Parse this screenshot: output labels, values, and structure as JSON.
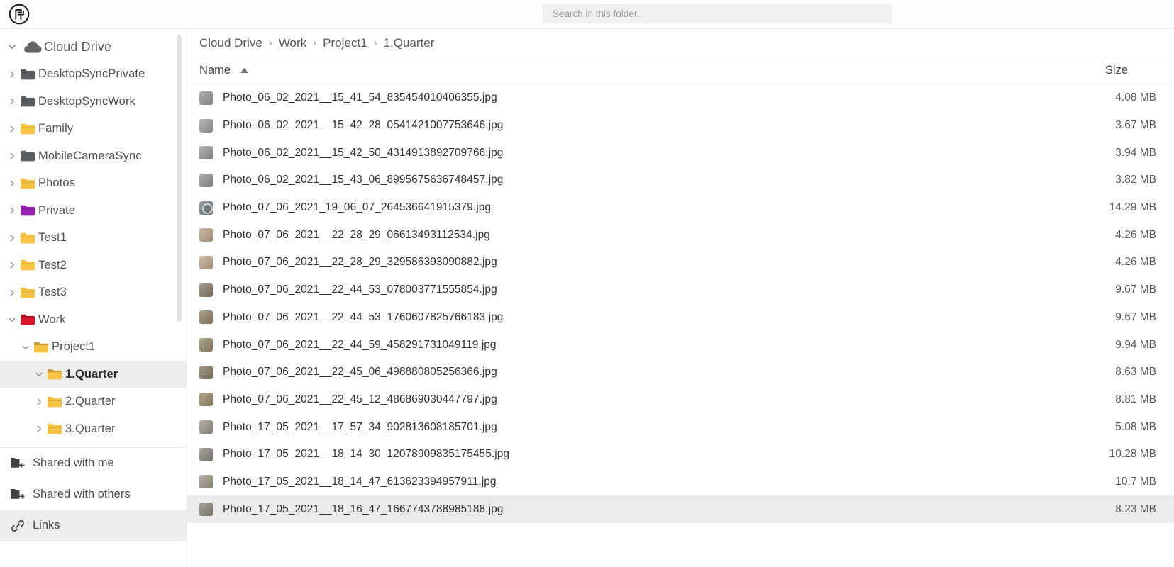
{
  "app": {
    "logo_name": "app-logo"
  },
  "search": {
    "placeholder": "Search in this folder..",
    "value": ""
  },
  "sidebar": {
    "root": {
      "label": "Cloud Drive",
      "icon": "cloud-icon",
      "expanded": true
    },
    "tree": [
      {
        "label": "DesktopSyncPrivate",
        "icon": "folder-icon",
        "color": "#5b5e62",
        "depth": 1,
        "expanded": false,
        "selected": false
      },
      {
        "label": "DesktopSyncWork",
        "icon": "folder-icon",
        "color": "#5b5e62",
        "depth": 1,
        "expanded": false,
        "selected": false
      },
      {
        "label": "Family",
        "icon": "folder-icon",
        "color": "#f6c344",
        "depth": 1,
        "expanded": false,
        "selected": false
      },
      {
        "label": "MobileCameraSync",
        "icon": "folder-icon",
        "color": "#5b5e62",
        "depth": 1,
        "expanded": false,
        "selected": false
      },
      {
        "label": "Photos",
        "icon": "folder-icon",
        "color": "#f6c344",
        "depth": 1,
        "expanded": false,
        "selected": false
      },
      {
        "label": "Private",
        "icon": "folder-icon",
        "color": "#9b21b5",
        "depth": 1,
        "expanded": false,
        "selected": false
      },
      {
        "label": "Test1",
        "icon": "folder-icon",
        "color": "#f6c344",
        "depth": 1,
        "expanded": false,
        "selected": false
      },
      {
        "label": "Test2",
        "icon": "folder-icon",
        "color": "#f6c344",
        "depth": 1,
        "expanded": false,
        "selected": false
      },
      {
        "label": "Test3",
        "icon": "folder-icon",
        "color": "#f6c344",
        "depth": 1,
        "expanded": false,
        "selected": false
      },
      {
        "label": "Work",
        "icon": "folder-icon",
        "color": "#d7152b",
        "depth": 1,
        "expanded": true,
        "selected": false
      },
      {
        "label": "Project1",
        "icon": "folder-icon",
        "color": "#f6c344",
        "depth": 2,
        "expanded": true,
        "selected": false
      },
      {
        "label": "1.Quarter",
        "icon": "folder-icon",
        "color": "#f6c344",
        "depth": 3,
        "expanded": true,
        "selected": true
      },
      {
        "label": "2.Quarter",
        "icon": "folder-icon",
        "color": "#f6c344",
        "depth": 3,
        "expanded": false,
        "selected": false
      },
      {
        "label": "3.Quarter",
        "icon": "folder-icon",
        "color": "#f6c344",
        "depth": 3,
        "expanded": false,
        "selected": false
      }
    ],
    "bottom_items": [
      {
        "label": "Shared with me",
        "icon": "shared-with-me-icon",
        "active": false
      },
      {
        "label": "Shared with others",
        "icon": "shared-with-others-icon",
        "active": false
      },
      {
        "label": "Links",
        "icon": "link-icon",
        "active": true
      }
    ]
  },
  "breadcrumb": {
    "separator": "›",
    "items": [
      "Cloud Drive",
      "Work",
      "Project1",
      "1.Quarter"
    ]
  },
  "columns": {
    "name": "Name",
    "size": "Size",
    "sort_icon": "sort-ascending-icon"
  },
  "files": [
    {
      "name": "Photo_06_02_2021__15_41_54_835454010406355.jpg",
      "size": "4.08 MB",
      "thumb": "#9b9b99",
      "selected": false
    },
    {
      "name": "Photo_06_02_2021__15_42_28_0541421007753646.jpg",
      "size": "3.67 MB",
      "thumb": "#a3a4a2",
      "selected": false
    },
    {
      "name": "Photo_06_02_2021__15_42_50_4314913892709766.jpg",
      "size": "3.94 MB",
      "thumb": "#9d9e9c",
      "selected": false
    },
    {
      "name": "Photo_06_02_2021__15_43_06_8995675636748457.jpg",
      "size": "3.82 MB",
      "thumb": "#97989a",
      "selected": false
    },
    {
      "name": "Photo_07_06_2021_19_06_07_264536641915379.jpg",
      "size": "14.29 MB",
      "thumb": "#7d8a8e",
      "selected": false
    },
    {
      "name": "Photo_07_06_2021__22_28_29_06613493112534.jpg",
      "size": "4.26 MB",
      "thumb": "#c0a98b",
      "selected": false
    },
    {
      "name": "Photo_07_06_2021__22_28_29_329586393090882.jpg",
      "size": "4.26 MB",
      "thumb": "#c3ac8e",
      "selected": false
    },
    {
      "name": "Photo_07_06_2021__22_44_53_078003771555854.jpg",
      "size": "9.67 MB",
      "thumb": "#8d7f6c",
      "selected": false
    },
    {
      "name": "Photo_07_06_2021__22_44_53_1760607825766183.jpg",
      "size": "9.67 MB",
      "thumb": "#97886e",
      "selected": false
    },
    {
      "name": "Photo_07_06_2021__22_44_59_458291731049119.jpg",
      "size": "9.94 MB",
      "thumb": "#9a8c70",
      "selected": false
    },
    {
      "name": "Photo_07_06_2021__22_45_06_498880805256366.jpg",
      "size": "8.63 MB",
      "thumb": "#8e7f6a",
      "selected": false
    },
    {
      "name": "Photo_07_06_2021__22_45_12_486869030447797.jpg",
      "size": "8.81 MB",
      "thumb": "#a08f71",
      "selected": false
    },
    {
      "name": "Photo_17_05_2021__17_57_34_902813608185701.jpg",
      "size": "5.08 MB",
      "thumb": "#a09a8c",
      "selected": false
    },
    {
      "name": "Photo_17_05_2021__18_14_30_12078909835175455.jpg",
      "size": "10.28 MB",
      "thumb": "#8f8c83",
      "selected": false
    },
    {
      "name": "Photo_17_05_2021__18_14_47_613623394957911.jpg",
      "size": "10.7 MB",
      "thumb": "#a49d8e",
      "selected": false
    },
    {
      "name": "Photo_17_05_2021__18_16_47_1667743788985188.jpg",
      "size": "8.23 MB",
      "thumb": "#8e8a7e",
      "selected": true
    }
  ]
}
